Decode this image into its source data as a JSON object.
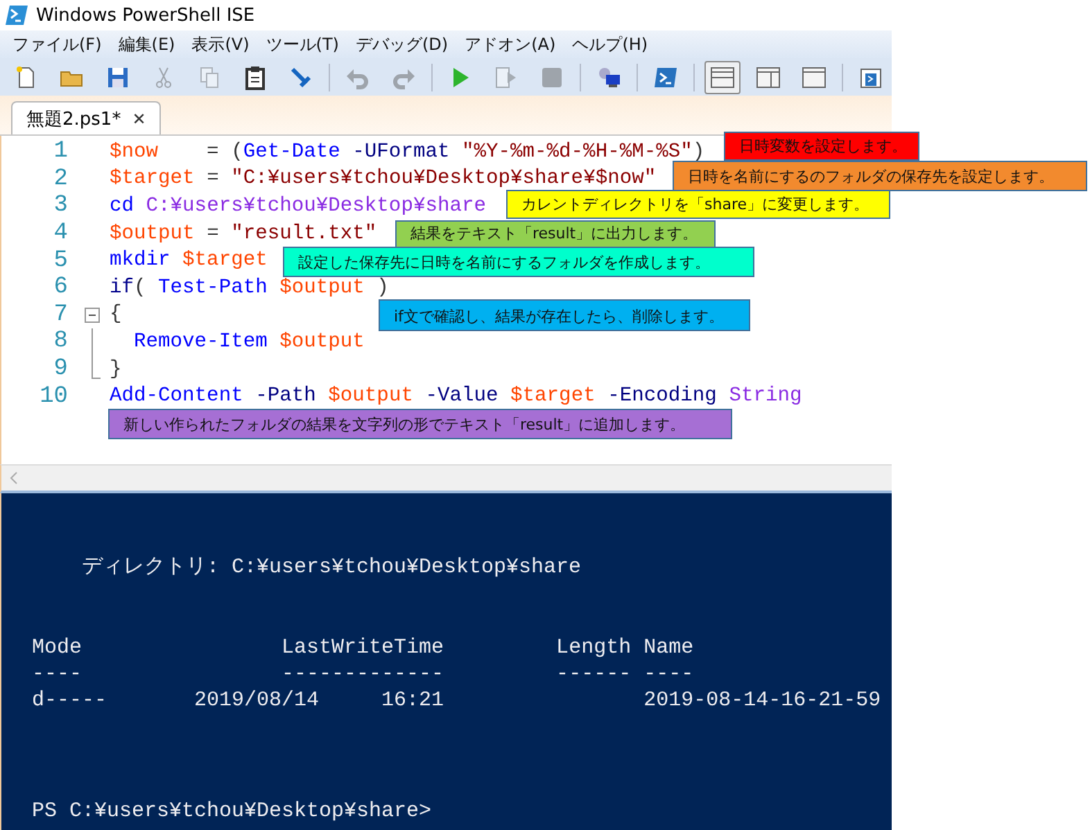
{
  "window": {
    "title": "Windows PowerShell ISE"
  },
  "menu": [
    "ファイル(F)",
    "編集(E)",
    "表示(V)",
    "ツール(T)",
    "デバッグ(D)",
    "アドオン(A)",
    "ヘルプ(H)"
  ],
  "toolbar": [
    {
      "kind": "new",
      "disabled": false
    },
    {
      "kind": "open",
      "disabled": false
    },
    {
      "kind": "save",
      "disabled": false
    },
    {
      "kind": "cut",
      "disabled": true
    },
    {
      "kind": "copy",
      "disabled": true
    },
    {
      "kind": "paste",
      "disabled": false
    },
    {
      "kind": "clear",
      "disabled": false
    },
    {
      "kind": "separator"
    },
    {
      "kind": "undo",
      "disabled": true
    },
    {
      "kind": "redo",
      "disabled": true
    },
    {
      "kind": "separator"
    },
    {
      "kind": "run",
      "disabled": false
    },
    {
      "kind": "runsel",
      "disabled": true
    },
    {
      "kind": "stop",
      "disabled": true
    },
    {
      "kind": "separator"
    },
    {
      "kind": "remote",
      "disabled": false
    },
    {
      "kind": "separator"
    },
    {
      "kind": "console",
      "disabled": false
    },
    {
      "kind": "separator"
    },
    {
      "kind": "layouttop",
      "disabled": false,
      "selected": true
    },
    {
      "kind": "layoutright",
      "disabled": false,
      "selected": false
    },
    {
      "kind": "layoutmax",
      "disabled": false,
      "selected": false
    },
    {
      "kind": "separator"
    },
    {
      "kind": "commands",
      "disabled": false
    }
  ],
  "tabs": [
    {
      "label": "無題2.ps1*",
      "close": "✕",
      "selected": true
    }
  ],
  "editor": {
    "lines": [
      {
        "number": "1",
        "tokens": [
          {
            "kind": "var",
            "text": "$now"
          },
          {
            "kind": "op",
            "text": "    = ("
          },
          {
            "kind": "cmd",
            "text": "Get-Date"
          },
          {
            "kind": "param",
            "text": " -UFormat "
          },
          {
            "kind": "str",
            "text": "\"%Y-%m-%d-%H-%M-%S\""
          },
          {
            "kind": "op",
            "text": ")"
          }
        ]
      },
      {
        "number": "2",
        "tokens": [
          {
            "kind": "var",
            "text": "$target"
          },
          {
            "kind": "op",
            "text": " = "
          },
          {
            "kind": "str",
            "text": "\"C:¥users¥tchou¥Desktop¥share¥$now\""
          }
        ]
      },
      {
        "number": "3",
        "tokens": [
          {
            "kind": "cmd",
            "text": "cd "
          },
          {
            "kind": "arg",
            "text": "C:¥users¥tchou¥Desktop¥share"
          }
        ]
      },
      {
        "number": "4",
        "tokens": [
          {
            "kind": "var",
            "text": "$output"
          },
          {
            "kind": "op",
            "text": " = "
          },
          {
            "kind": "str",
            "text": "\"result.txt\""
          }
        ]
      },
      {
        "number": "5",
        "tokens": [
          {
            "kind": "cmd",
            "text": "mkdir "
          },
          {
            "kind": "var",
            "text": "$target"
          }
        ]
      },
      {
        "number": "6",
        "tokens": [
          {
            "kind": "kw",
            "text": "if"
          },
          {
            "kind": "op",
            "text": "( "
          },
          {
            "kind": "cmd",
            "text": "Test-Path "
          },
          {
            "kind": "var",
            "text": "$output"
          },
          {
            "kind": "op",
            "text": " )"
          }
        ]
      },
      {
        "number": "7",
        "kind": "foldstart",
        "tokens": [
          {
            "kind": "op",
            "text": "{"
          }
        ]
      },
      {
        "number": "8",
        "kind": "foldbody",
        "tokens": [
          {
            "kind": "cmd",
            "text": "  Remove-Item "
          },
          {
            "kind": "var",
            "text": "$output"
          }
        ]
      },
      {
        "number": "9",
        "kind": "foldend",
        "tokens": [
          {
            "kind": "op",
            "text": "}"
          }
        ]
      },
      {
        "number": "10",
        "tokens": [
          {
            "kind": "cmd",
            "text": "Add-Content"
          },
          {
            "kind": "param",
            "text": " -Path "
          },
          {
            "kind": "var",
            "text": "$output"
          },
          {
            "kind": "param",
            "text": " -Value "
          },
          {
            "kind": "var",
            "text": "$target"
          },
          {
            "kind": "param",
            "text": " -Encoding "
          },
          {
            "kind": "arg",
            "text": "String"
          }
        ]
      }
    ]
  },
  "annotations": [
    {
      "text": "日時変数を設定します。",
      "color": "#ff0000"
    },
    {
      "text": "日時を名前にするのフォルダの保存先を設定します。",
      "color": "#f28a2e"
    },
    {
      "text": "カレントディレクトリを「share」に変更します。",
      "color": "#ffff00"
    },
    {
      "text": "結果をテキスト「result」に出力します。",
      "color": "#92d050"
    },
    {
      "text": "設定した保存先に日時を名前にするフォルダを作成します。",
      "color": "#00ffcc"
    },
    {
      "text": "if文で確認し、結果が存在したら、削除します。",
      "color": "#00b0f0"
    },
    {
      "text": "新しい作られたフォルダの結果を文字列の形でテキスト「result」に追加します。",
      "color": "#a66fd4"
    }
  ],
  "console": {
    "directory": "    ディレクトリ: C:¥users¥tchou¥Desktop¥share",
    "header": "Mode                LastWriteTime         Length Name",
    "rule": "----                -------------         ------ ----",
    "rows": [
      "d-----       2019/08/14     16:21                2019-08-14-16-21-59"
    ],
    "prompt": "PS C:¥users¥tchou¥Desktop¥share>"
  }
}
